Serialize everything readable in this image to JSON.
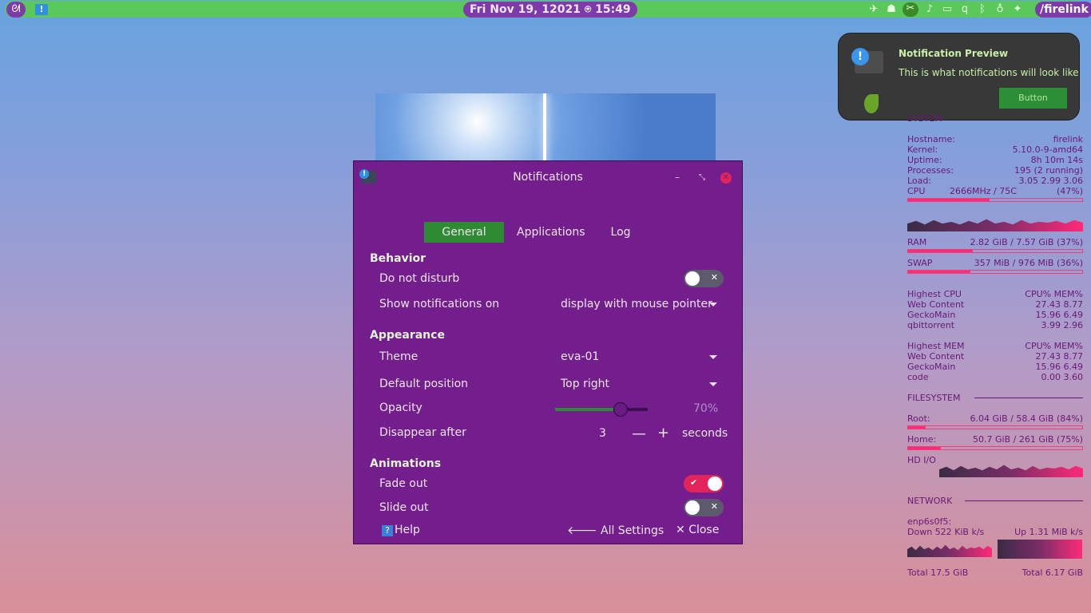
{
  "panel": {
    "clock": "Fri Nov 19, 12021 ⍟ 15:49",
    "workspace": "/firelink",
    "menu_glyph": "ᘛ",
    "tray_icons": [
      "network-icon",
      "game-icon",
      "hide-icon",
      "volume-icon",
      "display-icon",
      "qbittorrent-icon",
      "bluetooth-icon",
      "bulb-icon",
      "wifi-icon"
    ]
  },
  "dialog": {
    "title": "Notifications",
    "tabs": [
      "General",
      "Applications",
      "Log"
    ],
    "behavior": {
      "heading": "Behavior",
      "dnd_label": "Do not disturb",
      "show_on_label": "Show notifications on",
      "show_on_value": "display with mouse pointer"
    },
    "appearance": {
      "heading": "Appearance",
      "theme_label": "Theme",
      "theme_value": "eva-01",
      "position_label": "Default position",
      "position_value": "Top right",
      "opacity_label": "Opacity",
      "opacity_value": "70%",
      "opacity_fraction": 0.7,
      "disappear_label": "Disappear after",
      "disappear_value": "3",
      "disappear_unit": "seconds"
    },
    "animations": {
      "heading": "Animations",
      "fade_label": "Fade out",
      "fade_on": true,
      "slide_label": "Slide out",
      "slide_on": false
    },
    "footer": {
      "help": "Help",
      "all_settings": "All Settings",
      "close": "Close"
    }
  },
  "preview": {
    "title": "Notification Preview",
    "body": "This is what notifications will look like",
    "button": "Button"
  },
  "conky": {
    "system_header": "SYSTEM",
    "hostname_label": "Hostname:",
    "hostname": "firelink",
    "kernel_label": "Kernel:",
    "kernel": "5.10.0-9-amd64",
    "uptime_label": "Uptime:",
    "uptime": "8h 10m 14s",
    "processes_label": "Processes:",
    "processes": "195 (2 running)",
    "load_label": "Load:",
    "load": "3.05 2.99 3.06",
    "cpu_label": "CPU",
    "cpu_freq": "2666MHz / 75C",
    "cpu_pct": "(47%)",
    "cpu_fraction": 0.47,
    "ram_label": "RAM",
    "ram": "2.82 GiB / 7.57 GiB (37%)",
    "ram_fraction": 0.37,
    "swap_label": "SWAP",
    "swap": "357 MiB / 976 MiB (36%)",
    "swap_fraction": 0.36,
    "high_cpu": {
      "header": "Highest CPU",
      "cols": "CPU% MEM%",
      "rows": [
        {
          "name": "Web Content",
          "vals": "27.43  8.77"
        },
        {
          "name": "GeckoMain",
          "vals": "15.96  6.49"
        },
        {
          "name": "qbittorrent",
          "vals": "3.99  2.96"
        }
      ]
    },
    "high_mem": {
      "header": "Highest MEM",
      "cols": "CPU% MEM%",
      "rows": [
        {
          "name": "Web Content",
          "vals": "27.43  8.77"
        },
        {
          "name": "GeckoMain",
          "vals": "15.96  6.49"
        },
        {
          "name": "code",
          "vals": "0.00  3.60"
        }
      ]
    },
    "fs_header": "FILESYSTEM",
    "root_label": "Root:",
    "root": "6.04 GiB / 58.4 GiB (84%)",
    "root_fraction": 0.1,
    "home_label": "Home:",
    "home": "50.7 GiB / 261 GiB (75%)",
    "home_fraction": 0.19,
    "hdio_label": "HD I/O",
    "net_header": "NETWORK",
    "iface": "enp6s0f5:",
    "down": "Down 522 KiB k/s",
    "up": "Up 1.31 MiB k/s",
    "total_down": "Total 17.5 GiB",
    "total_up": "Total 6.17 GiB"
  }
}
